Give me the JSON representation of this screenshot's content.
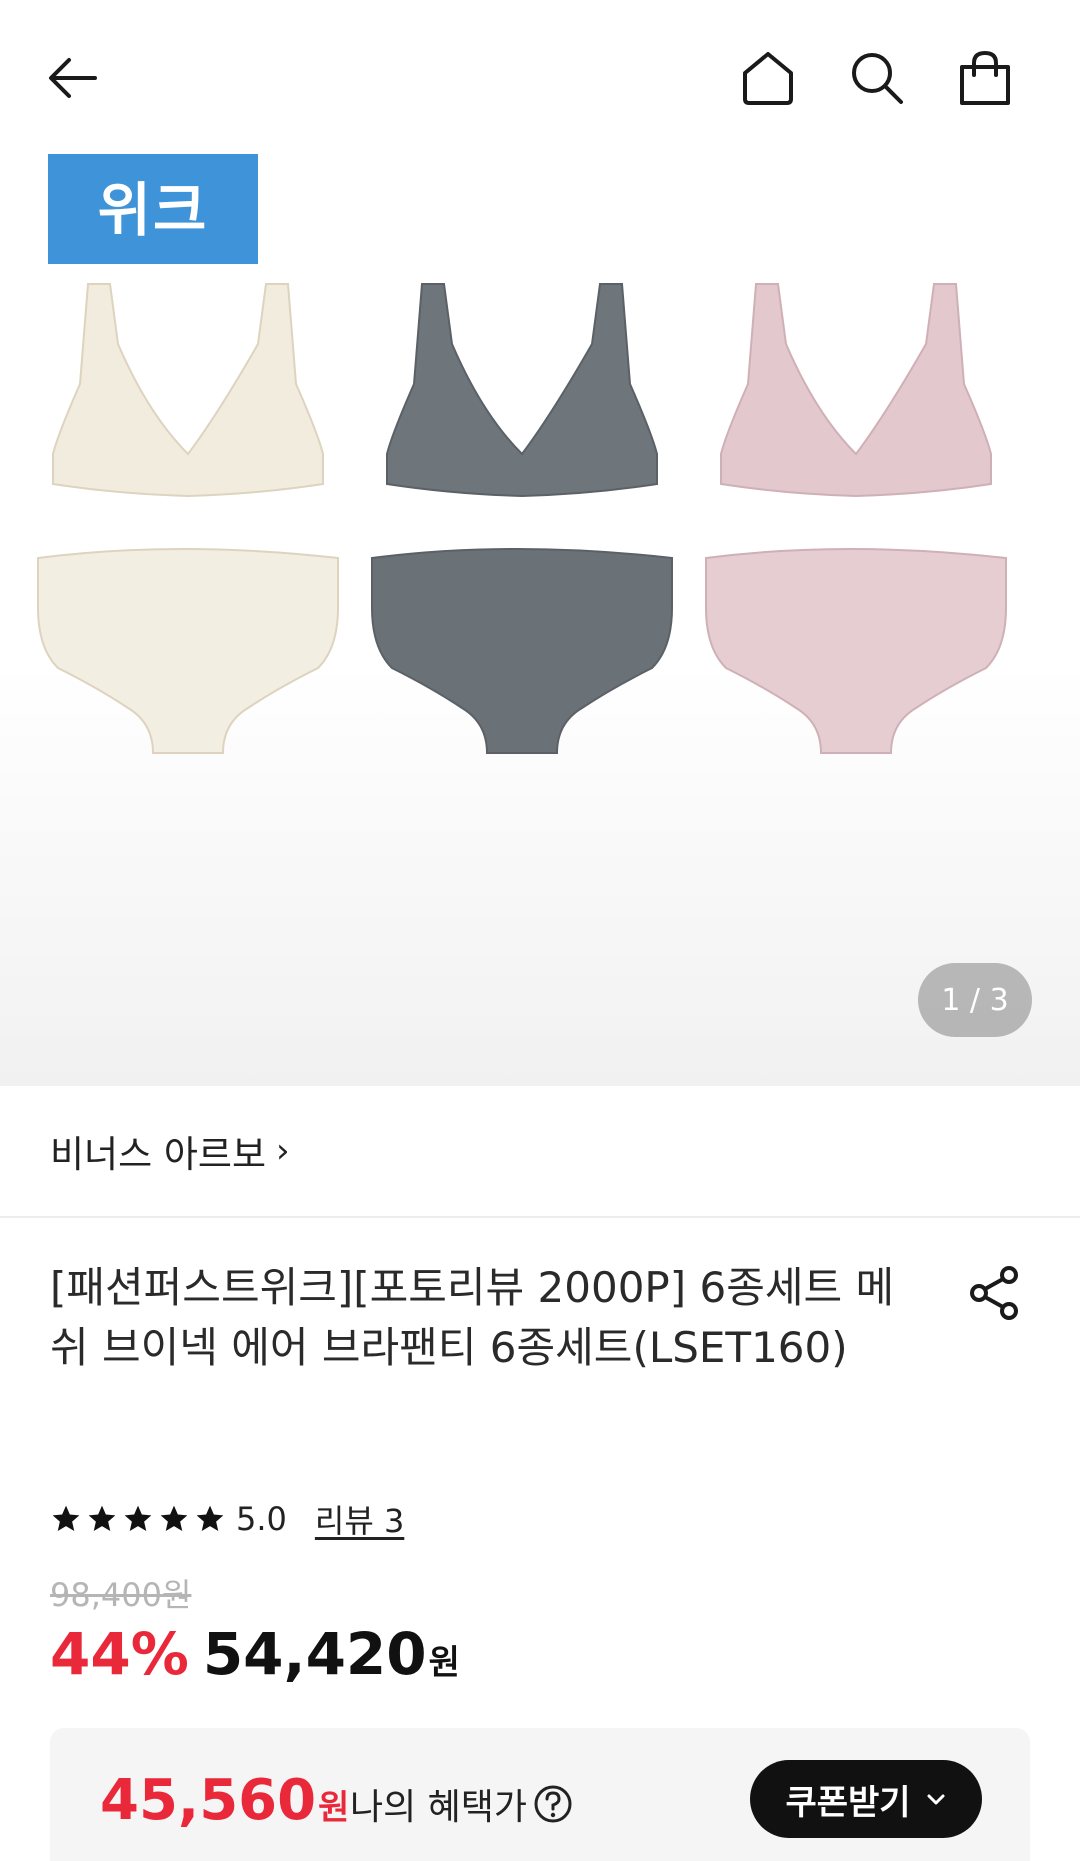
{
  "header": {
    "back_icon": "arrow-left-icon",
    "home_icon": "home-icon",
    "search_icon": "search-icon",
    "cart_icon": "shopping-bag-icon"
  },
  "gallery": {
    "badge": "위크",
    "badge_color": "#3f94d9",
    "pager": "1 / 3",
    "colors": [
      "#f2ecdf",
      "#6e757b",
      "#e3c8cd"
    ]
  },
  "brand": {
    "name": "비너스 아르보",
    "chevron": "›"
  },
  "product": {
    "title": "[패션퍼스트위크][포토리뷰 2000P] 6종세트 메쉬 브이넥 에어 브라팬티 6종세트(LSET160)",
    "share_icon": "share-icon",
    "rating": "5.0",
    "stars": 5,
    "review_link": "리뷰 3"
  },
  "price": {
    "original": "98,400원",
    "discount": "44%",
    "sale": "54,420",
    "won": "원",
    "accent_color": "#e9283a"
  },
  "benefit": {
    "price": "45,560",
    "won": "원",
    "label": "나의 혜택가",
    "coupon_button": "쿠폰받기"
  }
}
